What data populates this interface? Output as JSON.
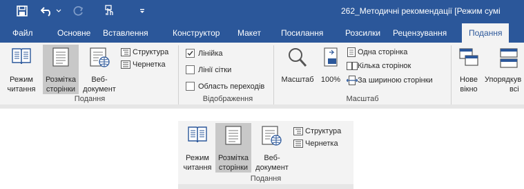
{
  "titlebar": {
    "doc_title": "262_Методичні рекомендації [Режим сумі",
    "qat_separator": "⇌"
  },
  "tabs": [
    {
      "label": "Файл"
    },
    {
      "label": "Основне"
    },
    {
      "label": "Вставлення"
    },
    {
      "label": "Конструктор"
    },
    {
      "label": "Макет"
    },
    {
      "label": "Посилання"
    },
    {
      "label": "Розсилки"
    },
    {
      "label": "Рецензування"
    },
    {
      "label": "Подання",
      "active": true
    }
  ],
  "ribbon": {
    "views_group": {
      "label": "Подання",
      "read_mode": [
        "Режим",
        "читання"
      ],
      "print_layout": [
        "Розмітка",
        "сторінки"
      ],
      "web_layout": [
        "Веб-",
        "документ"
      ],
      "outline": "Структура",
      "draft": "Чернетка"
    },
    "show_group": {
      "label": "Відображення",
      "ruler": {
        "label": "Лінійка",
        "checked": true
      },
      "gridlines": {
        "label": "Лінії сітки",
        "checked": false
      },
      "nav_pane": {
        "label": "Область переходів",
        "checked": false
      }
    },
    "zoom_group": {
      "label": "Масштаб",
      "zoom": "Масштаб",
      "hundred": "100%",
      "one_page": "Одна сторінка",
      "multi_page": "Кілька сторінок",
      "page_width": "За шириною сторінки"
    },
    "window_group": {
      "new_window": [
        "Нове",
        "вікно"
      ],
      "arrange_all": [
        "Упорядкув",
        "всі"
      ]
    }
  },
  "colors": {
    "titlebar": "#2b579a",
    "ribbon_bg": "#f3f3f3",
    "selected_btn": "#c8c8c8",
    "icon_blue": "#2b579a"
  }
}
